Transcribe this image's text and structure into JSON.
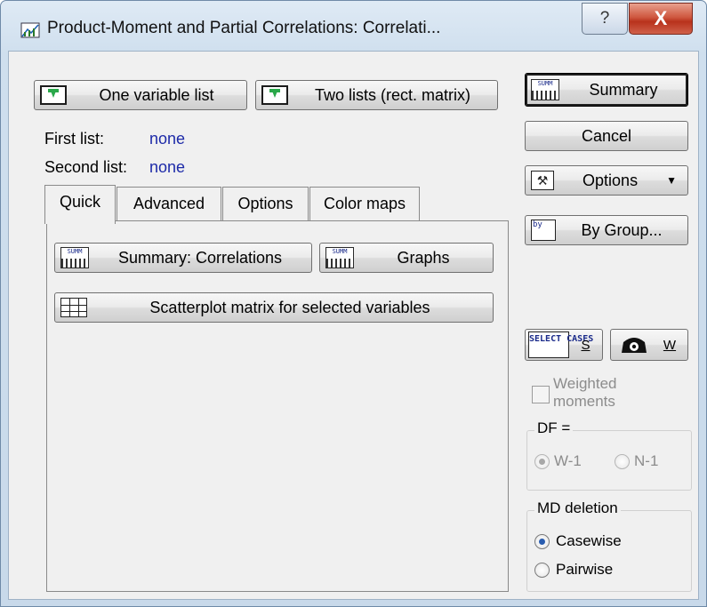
{
  "window": {
    "title": "Product-Moment and Partial Correlations: Correlati..."
  },
  "titlebar": {
    "help_label": "?",
    "close_label": "X"
  },
  "variables": {
    "one_list_label": "One variable list",
    "two_lists_label": "Two lists (rect. matrix)",
    "first_list_label": "First list:",
    "first_list_value": "none",
    "second_list_label": "Second list:",
    "second_list_value": "none"
  },
  "tabs": [
    {
      "label": "Quick",
      "active": true
    },
    {
      "label": "Advanced",
      "active": false
    },
    {
      "label": "Options",
      "active": false
    },
    {
      "label": "Color maps",
      "active": false
    }
  ],
  "quick": {
    "summary_correlations_label": "Summary: Correlations",
    "graphs_label": "Graphs",
    "scatterplot_label": "Scatterplot matrix for selected variables"
  },
  "side": {
    "summary_label": "Summary",
    "cancel_label": "Cancel",
    "options_label": "Options",
    "by_group_label": "By Group...",
    "select_cases_icon_text": "SELECT CASES",
    "select_cases_shortcut": "S",
    "weight_shortcut": "W",
    "weighted_moments_label": "Weighted moments",
    "df_group_title": "DF =",
    "df_options": [
      "W-1",
      "N-1"
    ],
    "df_selected": "W-1",
    "md_group_title": "MD deletion",
    "md_options": [
      "Casewise",
      "Pairwise"
    ],
    "md_selected": "Casewise"
  },
  "icons": {
    "summ_text": "SUMM",
    "by_text": "by"
  },
  "colors": {
    "list_value": "#1d2aa8",
    "close_button": "#c8432b",
    "disabled_text": "#8c8c8c"
  }
}
